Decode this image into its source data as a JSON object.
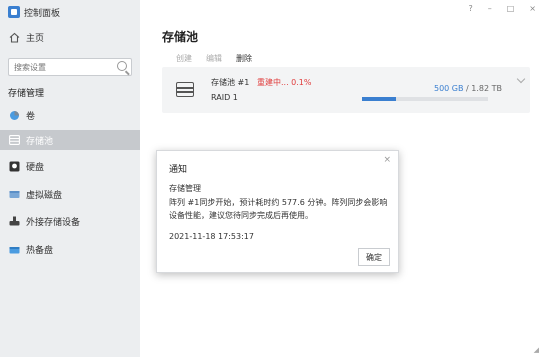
{
  "app": {
    "title": "控制面板",
    "icon": "control-panel-icon"
  },
  "window_controls": {
    "help": "?",
    "minimize": "–",
    "maximize": "□",
    "close": "×"
  },
  "sidebar": {
    "home": {
      "label": "主页",
      "icon": "home-icon"
    },
    "search": {
      "placeholder": "搜索设置"
    },
    "group_title": "存储管理",
    "items": [
      {
        "label": "卷",
        "icon": "volume-icon",
        "active": false
      },
      {
        "label": "存储池",
        "icon": "storage-pool-icon",
        "active": true
      },
      {
        "label": "硬盘",
        "icon": "hard-disk-icon",
        "active": false
      },
      {
        "label": "虚拟磁盘",
        "icon": "virtual-disk-icon",
        "active": false
      },
      {
        "label": "外接存储设备",
        "icon": "external-storage-icon",
        "active": false
      },
      {
        "label": "热备盘",
        "icon": "hot-spare-icon",
        "active": false
      }
    ]
  },
  "main": {
    "title": "存储池",
    "toolbar": {
      "create": "创建",
      "edit": "编辑",
      "delete": "删除"
    },
    "pool": {
      "name": "存储池 #1",
      "status": "重建中... 0.1%",
      "raid": "RAID 1",
      "used": "500 GB",
      "separator": " / ",
      "total": "1.82 TB",
      "usage_fraction": 0.27,
      "icon": "disk-array-icon"
    }
  },
  "dialog": {
    "title": "通知",
    "close": "×",
    "heading": "存储管理",
    "message": "阵列 #1同步开始，预计耗时约 577.6 分钟。阵列同步会影响设备性能，建议您待同步完成后再使用。",
    "timestamp": "2021-11-18 17:53:17",
    "ok_label": "确定"
  },
  "colors": {
    "accent": "#3a7fd0",
    "danger": "#e03c3c",
    "sidebar_bg": "#eceef0",
    "active_row": "#c6c9cd"
  }
}
